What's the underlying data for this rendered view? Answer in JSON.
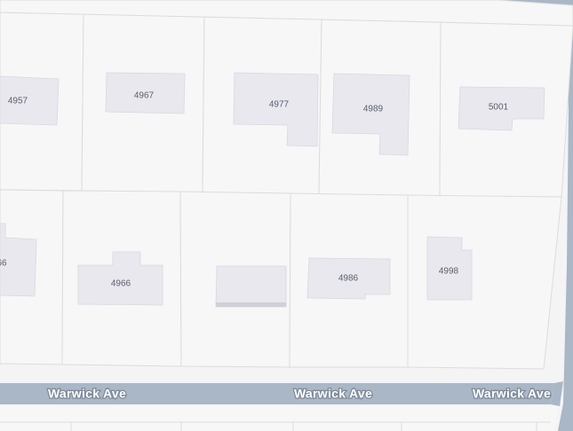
{
  "map": {
    "colors": {
      "background": "#f4f4f5",
      "parcel": "#f7f7f7",
      "parcel_line": "#dcdcdf",
      "building": "#e8e8ee",
      "road": "#a9b7c6",
      "label_text": "#5a5f6e",
      "street_label": "#ffffff"
    },
    "street": {
      "name": "Warwick Ave",
      "labels": [
        "Warwick Ave",
        "Warwick Ave",
        "Warwick Ave"
      ]
    },
    "north_row": {
      "addresses": [
        "4957",
        "4967",
        "4977",
        "4989",
        "5001"
      ]
    },
    "south_row": {
      "addresses": [
        "66",
        "4966",
        "",
        "4986",
        "4998"
      ]
    }
  }
}
